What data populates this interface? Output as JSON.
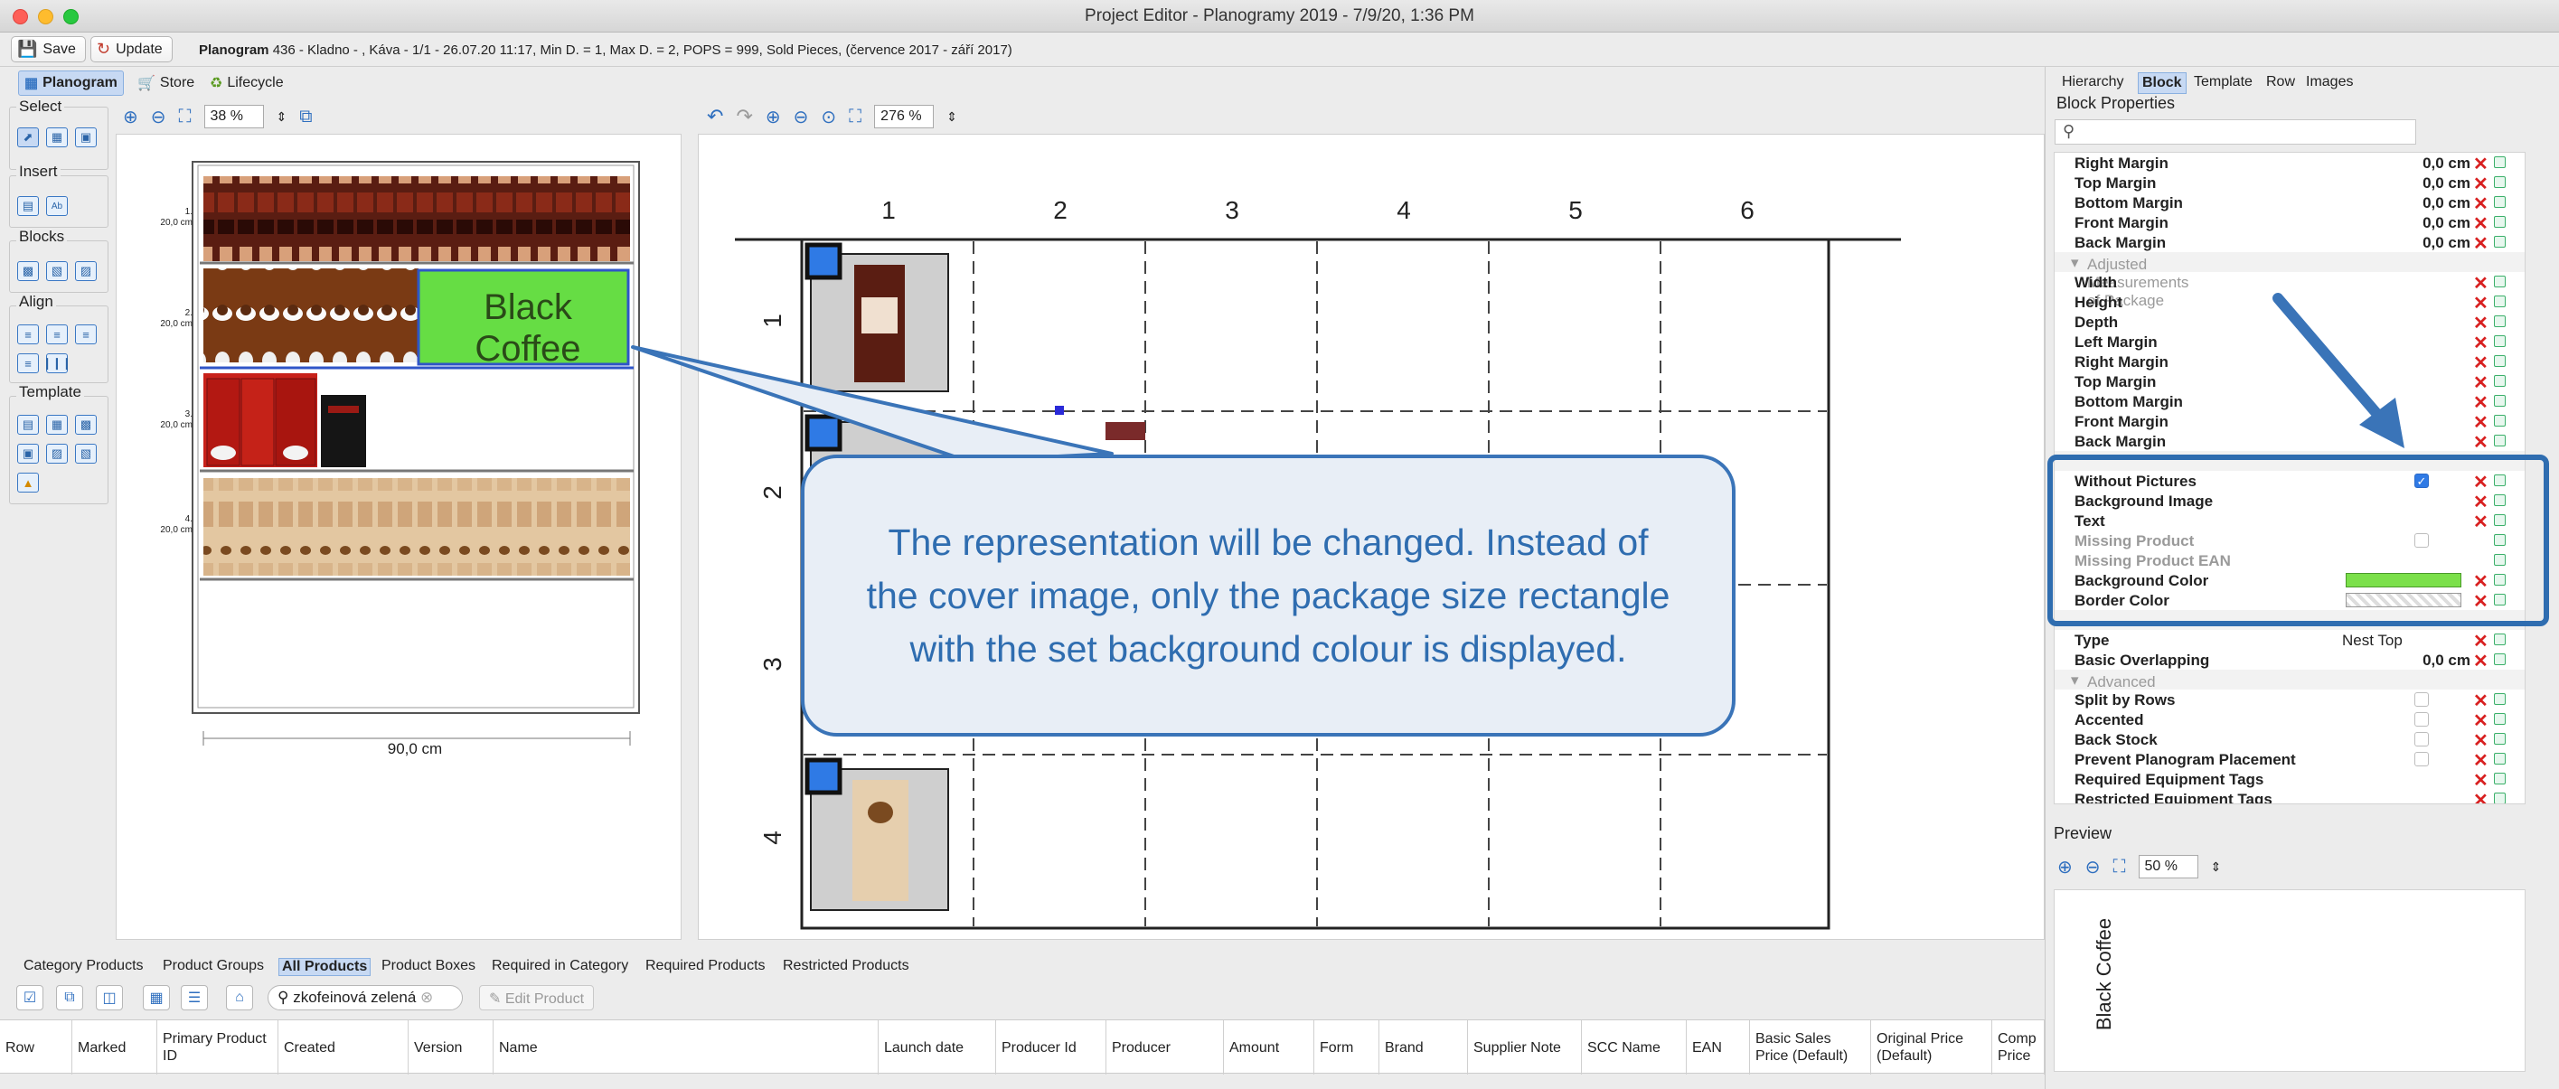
{
  "window": {
    "title": "Project Editor - Planogramy 2019 - 7/9/20, 1:36 PM"
  },
  "toolbar": {
    "save_label": "Save",
    "update_label": "Update",
    "info_bold": "Planogram",
    "info_text": " 436 - Kladno - , Káva - 1/1 - 26.07.20 11:17, Min D. = 1, Max D. = 2, POPS = 999, Sold Pieces, (července 2017 - září 2017)"
  },
  "left_tabs": [
    {
      "label": "Planogram",
      "active": true
    },
    {
      "label": "Store",
      "active": false
    },
    {
      "label": "Lifecycle",
      "active": false
    }
  ],
  "palette": {
    "select": "Select",
    "insert": "Insert",
    "blocks": "Blocks",
    "align": "Align",
    "template": "Template"
  },
  "left_canvas": {
    "zoom": "38 %",
    "shelf_labels": [
      {
        "num": "1.",
        "depth": "20,0 cm"
      },
      {
        "num": "2.",
        "depth": "20,0 cm"
      },
      {
        "num": "3.",
        "depth": "20,0 cm"
      },
      {
        "num": "4.",
        "depth": "20,0 cm"
      }
    ],
    "block_text": "Black Coffee",
    "width_label": "90,0 cm",
    "colors": {
      "block_green": "#66dd44",
      "block_border": "#2f55c8"
    }
  },
  "center_canvas": {
    "zoom": "276 %",
    "columns": [
      "1",
      "2",
      "3",
      "4",
      "5",
      "6"
    ],
    "rows": [
      "1",
      "2",
      "3",
      "4"
    ]
  },
  "callout": {
    "text": "The representation will be changed. Instead of the cover image, only the package size rectangle with the set background colour is displayed."
  },
  "right_panel": {
    "tabs": [
      {
        "label": "Hierarchy",
        "active": false
      },
      {
        "label": "Block",
        "active": true
      },
      {
        "label": "Template",
        "active": false
      },
      {
        "label": "Row",
        "active": false
      },
      {
        "label": "Images",
        "active": false
      }
    ],
    "title": "Block Properties",
    "rows_top": [
      {
        "label": "Right Margin",
        "value": "0,0 cm"
      },
      {
        "label": "Top Margin",
        "value": "0,0 cm"
      },
      {
        "label": "Bottom Margin",
        "value": "0,0 cm"
      },
      {
        "label": "Front Margin",
        "value": "0,0 cm"
      },
      {
        "label": "Back Margin",
        "value": "0,0 cm"
      }
    ],
    "group_adjusted": "Adjusted Measurements of Package",
    "rows_adjusted": [
      {
        "label": "Width"
      },
      {
        "label": "Height"
      },
      {
        "label": "Depth"
      },
      {
        "label": "Left Margin"
      },
      {
        "label": "Right Margin"
      },
      {
        "label": "Top Margin"
      },
      {
        "label": "Bottom Margin"
      },
      {
        "label": "Front Margin"
      },
      {
        "label": "Back Margin"
      }
    ],
    "rows_pictures": [
      {
        "label": "Without Pictures"
      },
      {
        "label": "Background Image"
      },
      {
        "label": "Text"
      },
      {
        "label": "Missing Product"
      },
      {
        "label": "Missing Product EAN"
      },
      {
        "label": "Background Color"
      },
      {
        "label": "Border Color"
      }
    ],
    "background_color": "#7be04a",
    "rows_nesting": [
      {
        "label": "Type",
        "value": "Nest Top"
      },
      {
        "label": "Basic Overlapping",
        "value": "0,0 cm"
      }
    ],
    "group_advanced": "Advanced",
    "rows_advanced": [
      {
        "label": "Split by Rows"
      },
      {
        "label": "Accented"
      },
      {
        "label": "Back Stock"
      },
      {
        "label": "Prevent Planogram Placement"
      },
      {
        "label": "Required Equipment Tags"
      },
      {
        "label": "Restricted Equipment Tags"
      }
    ],
    "preview_title": "Preview",
    "preview_zoom": "50 %",
    "preview_text": "Black Coffee"
  },
  "bottom": {
    "tabs": [
      {
        "label": "Category Products",
        "active": false
      },
      {
        "label": "Product Groups",
        "active": false
      },
      {
        "label": "All Products",
        "active": true
      },
      {
        "label": "Product Boxes",
        "active": false
      },
      {
        "label": "Required in Category",
        "active": false
      },
      {
        "label": "Required Products",
        "active": false
      },
      {
        "label": "Restricted Products",
        "active": false
      }
    ],
    "search_value": "zkofeinová zelená",
    "edit_product": "Edit Product",
    "columns": [
      "Row",
      "Marked",
      "Primary Product ID",
      "Created",
      "Version",
      "Name",
      "Launch date",
      "Producer Id",
      "Producer",
      "Amount",
      "Form",
      "Brand",
      "Supplier Note",
      "SCC Name",
      "EAN",
      "Basic Sales Price (Default)",
      "Original Price (Default)",
      "Comp Price"
    ]
  }
}
